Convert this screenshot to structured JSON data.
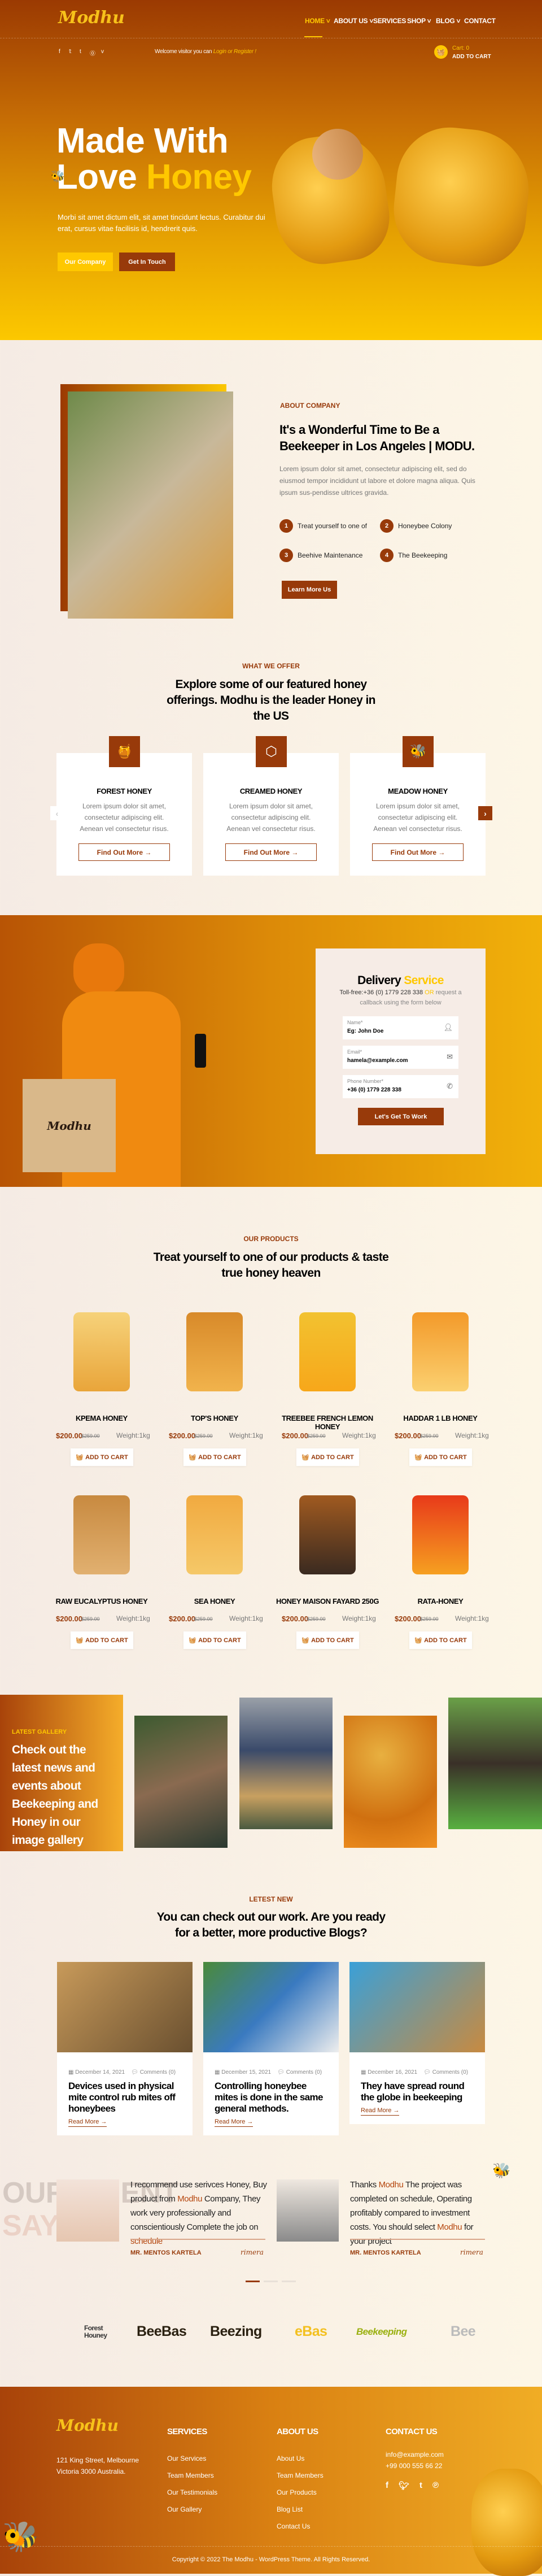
{
  "brand": {
    "logo": "Modhu",
    "accent": "#983a0a",
    "yellow": "#ffc800"
  },
  "nav": {
    "items": [
      "HOME",
      "ABOUT US",
      "SERVICES",
      "SHOP",
      "BLOG",
      "CONTACT"
    ],
    "active": "HOME"
  },
  "topbar": {
    "social": [
      "facebook-icon",
      "twitter-icon",
      "tumblr-icon",
      "pinterest-icon",
      "vimeo-icon"
    ],
    "welcome": "Welcome visitor you can",
    "login": "Login or Register !",
    "cart_count": "Cart: 0",
    "cart_label": "ADD TO CART"
  },
  "hero": {
    "line1": "Made With",
    "line2a": "Love",
    "line2b": "Honey",
    "text": "Morbi sit amet dictum elit, sit amet tincidunt lectus. Curabitur dui erat, cursus vitae facilisis id, hendrerit quis.",
    "btn1": "Our Company",
    "btn2": "Get In Touch"
  },
  "about": {
    "label": "ABOUT COMPANY",
    "title": "It's a Wonderful Time to Be a Beekeeper in Los Angeles | MODU.",
    "text": "Lorem ipsum dolor sit amet, consectetur adipiscing elit, sed do eiusmod tempor incididunt ut labore et dolore magna aliqua. Quis ipsum sus-pendisse ultrices gravida.",
    "items": [
      {
        "n": "1",
        "label": "Treat yourself to one of"
      },
      {
        "n": "2",
        "label": "Honeybee Colony"
      },
      {
        "n": "3",
        "label": "Beehive Maintenance"
      },
      {
        "n": "4",
        "label": "The Beekeeping"
      }
    ],
    "button": "Learn More Us"
  },
  "offer": {
    "label": "WHAT WE OFFER",
    "title": "Explore some of our featured honey offerings. Modhu is the leader Honey in the US",
    "cards": [
      {
        "title": "FOREST HONEY",
        "text": "Lorem ipsum dolor sit amet, consectetur adipiscing elit. Aenean vel consectetur risus.",
        "button": "Find Out More →"
      },
      {
        "title": "CREAMED HONEY",
        "text": "Lorem ipsum dolor sit amet, consectetur adipiscing elit. Aenean vel consectetur risus.",
        "button": "Find Out More →"
      },
      {
        "title": "MEADOW HONEY",
        "text": "Lorem ipsum dolor sit amet, consectetur adipiscing elit. Aenean vel consectetur risus.",
        "button": "Find Out More →"
      }
    ],
    "prev": "‹",
    "next": "›"
  },
  "delivery": {
    "title_a": "Delivery",
    "title_b": "Service",
    "toll_a": "Toll-free:+36 (0) 1779 228 338",
    "toll_or": "OR",
    "toll_b": "request a callback using the form below",
    "fields": [
      {
        "label": "Name*",
        "value": "Eg: John Doe"
      },
      {
        "label": "Email*",
        "value": "hamela@example.com"
      },
      {
        "label": "Phone Number*",
        "value": "+36 (0) 1779 228 338"
      }
    ],
    "button": "Let's Get To Work",
    "box_logo": "Modhu"
  },
  "products": {
    "label": "OUR PRODUCTS",
    "title": "Treat yourself to one of our products & taste true honey heaven",
    "cart_label": "ADD TO CART",
    "items": [
      {
        "name": "KPEMA HONEY",
        "price": "$200.00",
        "old": "$259.00",
        "weight": "Weight:1kg"
      },
      {
        "name": "TOP'S HONEY",
        "price": "$200.00",
        "old": "$259.00",
        "weight": "Weight:1kg"
      },
      {
        "name": "TREEBEE FRENCH LEMON HONEY",
        "price": "$200.00",
        "old": "$259.00",
        "weight": "Weight:1kg"
      },
      {
        "name": "HADDAR 1 LB HONEY",
        "price": "$200.00",
        "old": "$259.00",
        "weight": "Weight:1kg"
      },
      {
        "name": "RAW EUCALYPTUS HONEY",
        "price": "$200.00",
        "old": "$259.00",
        "weight": "Weight:1kg"
      },
      {
        "name": "SEA HONEY",
        "price": "$200.00",
        "old": "$259.00",
        "weight": "Weight:1kg"
      },
      {
        "name": "HONEY MAISON FAYARD 250G",
        "price": "$200.00",
        "old": "$259.00",
        "weight": "Weight:1kg"
      },
      {
        "name": "RATA-HONEY",
        "price": "$200.00",
        "old": "$259.00",
        "weight": "Weight:1kg"
      }
    ]
  },
  "gallery": {
    "label": "LATEST GALLERY",
    "title": "Check out the latest news and events about Beekeeping and Honey in our image gallery"
  },
  "blog": {
    "label": "LETEST NEW",
    "title": "You can check out our work. Are you ready for a better, more productive Blogs?",
    "read_more": "Read More →",
    "posts": [
      {
        "date": "December 14, 2021",
        "comments": "Comments (0)",
        "title": "Devices used in physical mite control rub mites off honeybees"
      },
      {
        "date": "December 15, 2021",
        "comments": "Comments (0)",
        "title": "Controlling honeybee mites is done in the same general methods."
      },
      {
        "date": "December 16, 2021",
        "comments": "Comments (0)",
        "title": "They have spread round the globe in beekeeping"
      }
    ]
  },
  "testimonials": {
    "bg_title_1": "OUR CLIENT",
    "bg_title_2": "SAYS",
    "items": [
      {
        "t1": "I recommend use serivces Honey, Buy product from",
        "h1": "Modhu",
        "t2": "Company, They work very professionally and conscientiously Complete the job on",
        "h2": "schedule",
        "t3": "",
        "name": "MR. MENTOS KARTELA",
        "sig": "rimera"
      },
      {
        "t1": "Thanks",
        "h1": "Modhu",
        "t2": "The project was completed on schedule, Operating profitably compared to investment costs. You should select",
        "h2": "Modhu",
        "t3": "for your project",
        "name": "MR. MENTOS KARTELA",
        "sig": "rimera"
      }
    ]
  },
  "partners": [
    "Forest Houney",
    "BeeBas",
    "Beezing",
    "eBas",
    "Beekeeping",
    "Bee"
  ],
  "footer": {
    "logo": "Modhu",
    "address": [
      "121 King Street, Melbourne",
      "Victoria 3000 Australia."
    ],
    "services": {
      "title": "SERVICES",
      "links": [
        "Our Services",
        "Team Members",
        "Our Testimonials",
        "Our Gallery"
      ]
    },
    "about": {
      "title": "ABOUT US",
      "links": [
        "About Us",
        "Team Members",
        "Our Products",
        "Blog List",
        "Contact Us"
      ]
    },
    "contact": {
      "title": "CONTACT US",
      "email": "info@example.com",
      "phone": "+99 000 555 66 22",
      "social": [
        "facebook-icon",
        "twitter-icon",
        "tumblr-icon",
        "pinterest-icon"
      ]
    },
    "copyright": "Copyright © 2022 The Modhu - WordPress Theme. All Rights Reserved."
  }
}
